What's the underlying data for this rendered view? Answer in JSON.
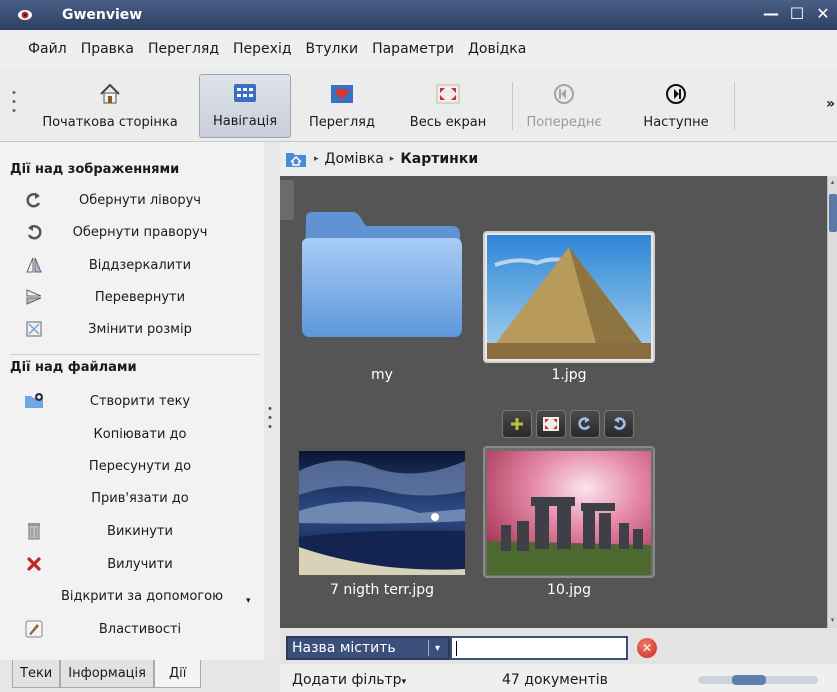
{
  "window": {
    "title": "Gwenview",
    "controls": [
      "—",
      "☐",
      "✕"
    ]
  },
  "menu": [
    "Файл",
    "Правка",
    "Перегляд",
    "Перехід",
    "Втулки",
    "Параметри",
    "Довідка"
  ],
  "toolbar": {
    "home": "Початкова сторінка",
    "browse": "Навігація",
    "view": "Перегляд",
    "fullscreen": "Весь екран",
    "previous": "Попереднє",
    "next": "Наступне",
    "more": "»"
  },
  "sidebar": {
    "image_actions_heading": "Дії над зображеннями",
    "image_actions": [
      "Обернути ліворуч",
      "Обернути праворуч",
      "Віддзеркалити",
      "Перевернути",
      "Змінити розмір"
    ],
    "file_actions_heading": "Дії над файлами",
    "file_actions": [
      "Створити теку",
      "Копіювати до",
      "Пересунути до",
      "Прив'язати до",
      "Викинути",
      "Вилучити",
      "Відкрити за допомогою",
      "Властивості"
    ]
  },
  "tabs": [
    "Теки",
    "Інформація",
    "Дії"
  ],
  "breadcrumb": {
    "parent": "Домівка",
    "current": "Картинки"
  },
  "items": [
    {
      "name": "my",
      "type": "folder"
    },
    {
      "name": "1.jpg",
      "type": "image"
    },
    {
      "name": "7 nigth terr.jpg",
      "type": "image"
    },
    {
      "name": "10.jpg",
      "type": "image"
    }
  ],
  "filter": {
    "type": "Назва містить",
    "value": ""
  },
  "status": {
    "add_filter": "Додати фільтр",
    "count": "47 документів",
    "zoom_level": 0.4
  }
}
